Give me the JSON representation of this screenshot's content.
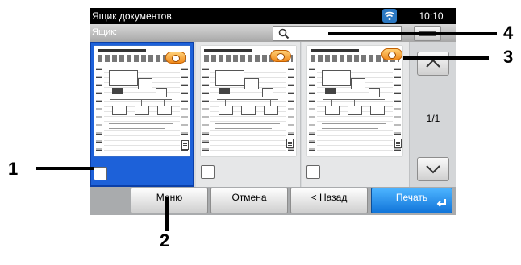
{
  "status_bar": {
    "title": "Ящик документов.",
    "time": "10:10"
  },
  "info_bar": {
    "label": "Ящик:"
  },
  "thumbnails": [
    {
      "selected": true
    },
    {
      "selected": false
    },
    {
      "selected": false
    }
  ],
  "pager": {
    "page": "1/1"
  },
  "buttons": {
    "menu": "Меню",
    "cancel": "Отмена",
    "back": "< Назад",
    "print": "Печать"
  },
  "callouts": [
    "1",
    "2",
    "3",
    "4"
  ],
  "colors": {
    "accent": "#1d61d9",
    "primary_button": "#1a86ea",
    "copies_badge": "#f59a2a"
  }
}
